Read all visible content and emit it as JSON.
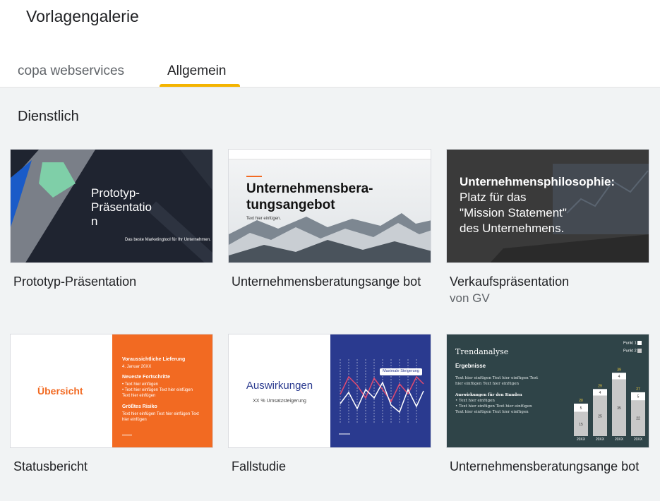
{
  "header": {
    "title": "Vorlagengalerie"
  },
  "tabs": [
    {
      "label": "copa webservices"
    },
    {
      "label": "Allgemein",
      "active": true
    }
  ],
  "section": {
    "title": "Dienstlich"
  },
  "templates": [
    {
      "name": "Prototyp-Präsentation",
      "thumb": {
        "title_lines": [
          "Prototyp-",
          "Präsentatio",
          "n"
        ],
        "subtitle": "Das beste Marketingtool für Ihr Unternehmen."
      }
    },
    {
      "name": "Unternehmensberatungsange bot",
      "thumb": {
        "title_lines": [
          "Unternehmensbera-",
          "tungsangebot"
        ],
        "subtitle": "Text hier einfügen."
      }
    },
    {
      "name": "Verkaufspräsentation",
      "subtitle": "von GV",
      "thumb": {
        "title_lines": [
          "Unternehmensphilosophie:",
          "Platz für das",
          "\"Mission Statement\"",
          "des Unternehmens."
        ]
      }
    },
    {
      "name": "Statusbericht",
      "thumb": {
        "heading": "Übersicht",
        "blocks": [
          {
            "head": "Voraussichtliche Lieferung",
            "lines": [
              "4. Januar 20XX"
            ]
          },
          {
            "head": "Neueste Fortschritte",
            "lines": [
              "•  Text hier einfügen",
              "•  Text hier einfügen Text hier einfügen",
              "    Text hier einfügen"
            ]
          },
          {
            "head": "Größtes Risiko",
            "lines": [
              "Text hier einfügen Text hier einfügen Text",
              "hier einfügen"
            ]
          }
        ]
      }
    },
    {
      "name": "Fallstudie",
      "thumb": {
        "heading": "Auswirkungen",
        "subtitle": "XX % Umsatzsteigerung",
        "callout": "Maximale Steigerung"
      }
    },
    {
      "name": "Unternehmensberatungsange bot",
      "thumb": {
        "title": "Trendanalyse",
        "section": "Ergebnisse",
        "text_lines": [
          "Text hier einfügen Text hier einfügen Text",
          "hier einfügen Text hier einfügen"
        ],
        "sub": "Auswirkungen für den Kunden",
        "bullets": [
          "•  Text hier einfügen",
          "•  Text hier einfügen Text hier einfügen",
          "    Text hier einfügen Text hier einfügen"
        ],
        "legend": [
          "Punkt 1",
          "Punkt 2"
        ]
      }
    }
  ],
  "chart_data": {
    "type": "bar",
    "categories": [
      "20XX",
      "20XX",
      "20XX",
      "20XX"
    ],
    "series": [
      {
        "name": "Punkt 1",
        "values": [
          5,
          4,
          4,
          5
        ]
      },
      {
        "name": "Punkt 2",
        "values": [
          15,
          25,
          35,
          22
        ]
      }
    ],
    "totals": [
      20,
      29,
      39,
      27
    ]
  },
  "colors": {
    "accent": "#f4b400",
    "orange": "#f26a22",
    "navy": "#2a3a8f",
    "teal": "#2f4448"
  }
}
